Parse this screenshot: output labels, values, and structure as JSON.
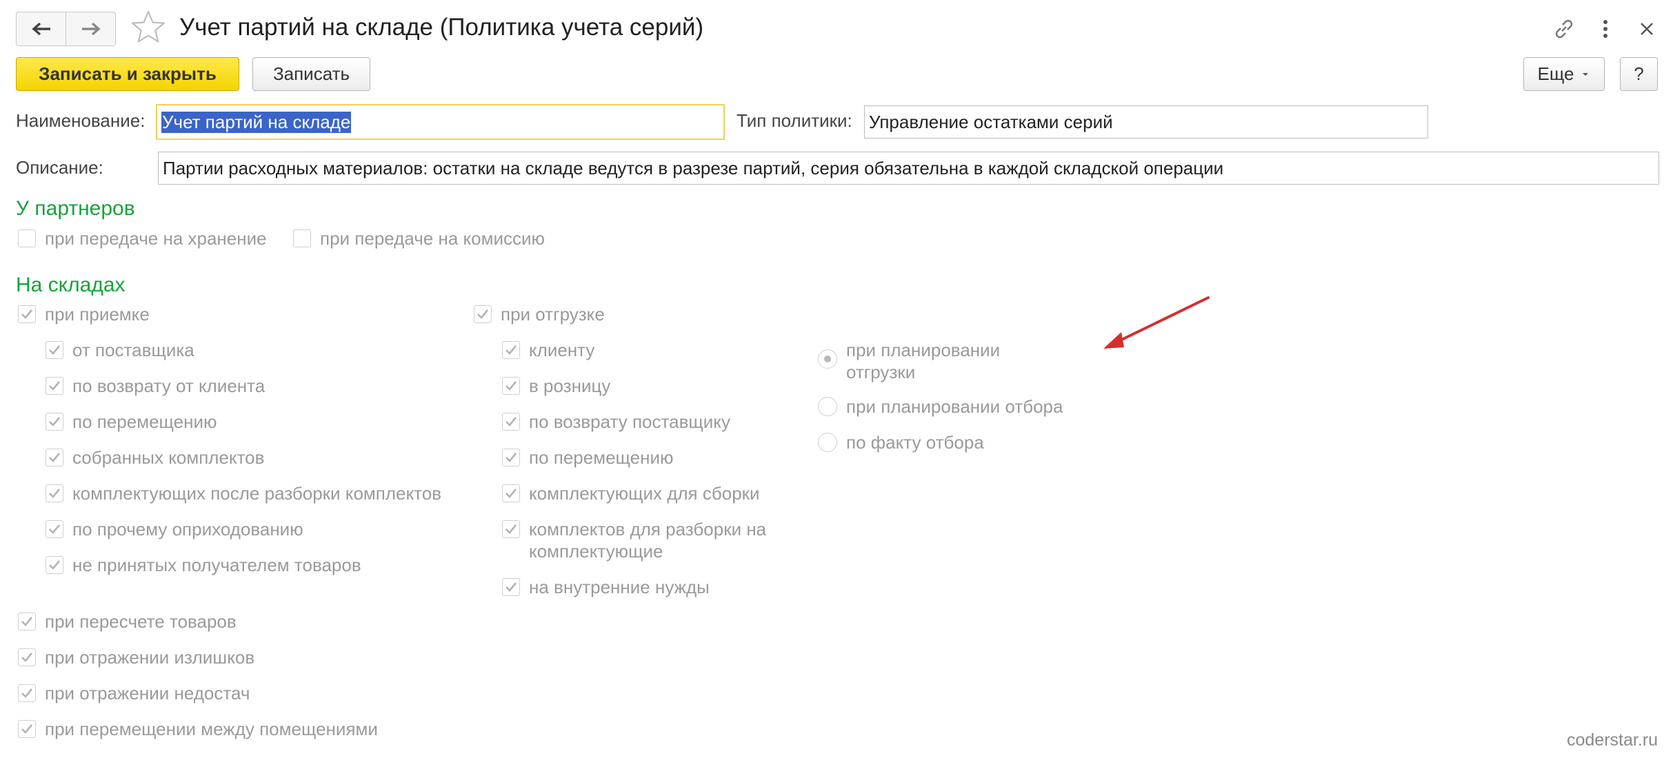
{
  "window": {
    "title": "Учет партий на складе (Политика учета серий)"
  },
  "toolbar": {
    "save_close_label": "Записать и закрыть",
    "save_label": "Записать",
    "more_label": "Еще",
    "help_label": "?"
  },
  "form": {
    "name_label": "Наименование:",
    "name_value": "Учет партий на складе",
    "policy_type_label": "Тип политики:",
    "policy_type_value": "Управление остатками серий",
    "description_label": "Описание:",
    "description_value": "Партии расходных материалов: остатки на складе ведутся в разрезе партий, серия обязательна в каждой складской операции"
  },
  "partners": {
    "heading": "У партнеров",
    "storage_label": "при передаче на хранение",
    "storage_checked": false,
    "commission_label": "при передаче на комиссию",
    "commission_checked": false
  },
  "warehouses": {
    "heading": "На складах",
    "receipt": {
      "label": "при приемке",
      "checked": true,
      "items": [
        {
          "label": "от поставщика",
          "checked": true
        },
        {
          "label": "по возврату от клиента",
          "checked": true
        },
        {
          "label": "по перемещению",
          "checked": true
        },
        {
          "label": "собранных комплектов",
          "checked": true
        },
        {
          "label": "комплектующих после разборки комплектов",
          "checked": true
        },
        {
          "label": "по прочему оприходованию",
          "checked": true
        },
        {
          "label": "не принятых получателем товаров",
          "checked": true
        }
      ]
    },
    "shipment": {
      "label": "при отгрузке",
      "checked": true,
      "items": [
        {
          "label": "клиенту",
          "checked": true
        },
        {
          "label": "в розницу",
          "checked": true
        },
        {
          "label": "по возврату поставщику",
          "checked": true
        },
        {
          "label": "по перемещению",
          "checked": true
        },
        {
          "label": "комплектующих для сборки",
          "checked": true
        },
        {
          "label": "комплектов для разборки на комплектующие",
          "checked": true
        },
        {
          "label": "на внутренние нужды",
          "checked": true
        }
      ]
    },
    "timing": {
      "options": [
        {
          "label": "при планировании отгрузки",
          "selected": true
        },
        {
          "label": "при планировании отбора",
          "selected": false
        },
        {
          "label": "по факту отбора",
          "selected": false
        }
      ]
    },
    "other": [
      {
        "label": "при пересчете товаров",
        "checked": true
      },
      {
        "label": "при отражении излишков",
        "checked": true
      },
      {
        "label": "при отражении недостач",
        "checked": true
      },
      {
        "label": "при перемещении между помещениями",
        "checked": true
      }
    ]
  },
  "annotation": {
    "arrow_color": "#d62d2d"
  },
  "watermark": "coderstar.ru"
}
